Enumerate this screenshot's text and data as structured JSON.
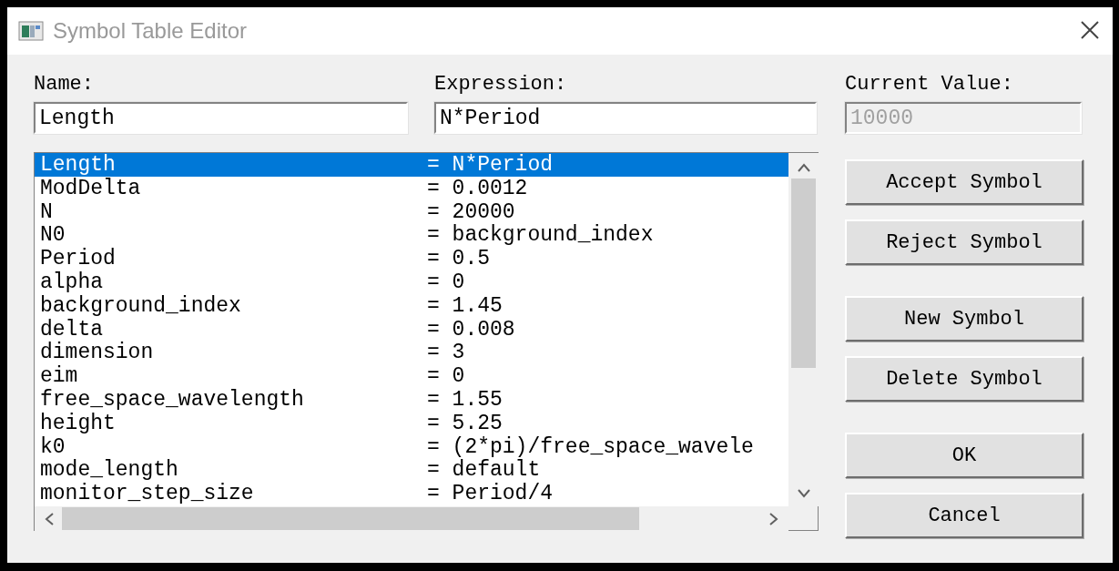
{
  "window": {
    "title": "Symbol Table Editor"
  },
  "fields": [
    {
      "label": "Name:",
      "value": "Length",
      "disabled": false
    },
    {
      "label": "Expression:",
      "value": "N*Period",
      "disabled": false
    },
    {
      "label": "Current Value:",
      "value": "10000",
      "disabled": true
    }
  ],
  "symbols": [
    {
      "name": "Length",
      "value": "= N*Period",
      "selected": true
    },
    {
      "name": "ModDelta",
      "value": "= 0.0012",
      "selected": false
    },
    {
      "name": "N",
      "value": "= 20000",
      "selected": false
    },
    {
      "name": "N0",
      "value": "= background_index",
      "selected": false
    },
    {
      "name": "Period",
      "value": "= 0.5",
      "selected": false
    },
    {
      "name": "alpha",
      "value": "= 0",
      "selected": false
    },
    {
      "name": "background_index",
      "value": "= 1.45",
      "selected": false
    },
    {
      "name": "delta",
      "value": "= 0.008",
      "selected": false
    },
    {
      "name": "dimension",
      "value": "= 3",
      "selected": false
    },
    {
      "name": "eim",
      "value": "= 0",
      "selected": false
    },
    {
      "name": "free_space_wavelength",
      "value": "= 1.55",
      "selected": false
    },
    {
      "name": "height",
      "value": "= 5.25",
      "selected": false
    },
    {
      "name": "k0",
      "value": "= (2*pi)/free_space_wavele",
      "selected": false
    },
    {
      "name": "mode_length",
      "value": "= default",
      "selected": false
    },
    {
      "name": "monitor_step_size",
      "value": "= Period/4",
      "selected": false
    }
  ],
  "buttons": [
    {
      "label": "Accept Symbol"
    },
    {
      "label": "Reject Symbol"
    },
    {
      "label": "New Symbol"
    },
    {
      "label": "Delete Symbol"
    },
    {
      "label": "OK"
    },
    {
      "label": "Cancel"
    }
  ]
}
